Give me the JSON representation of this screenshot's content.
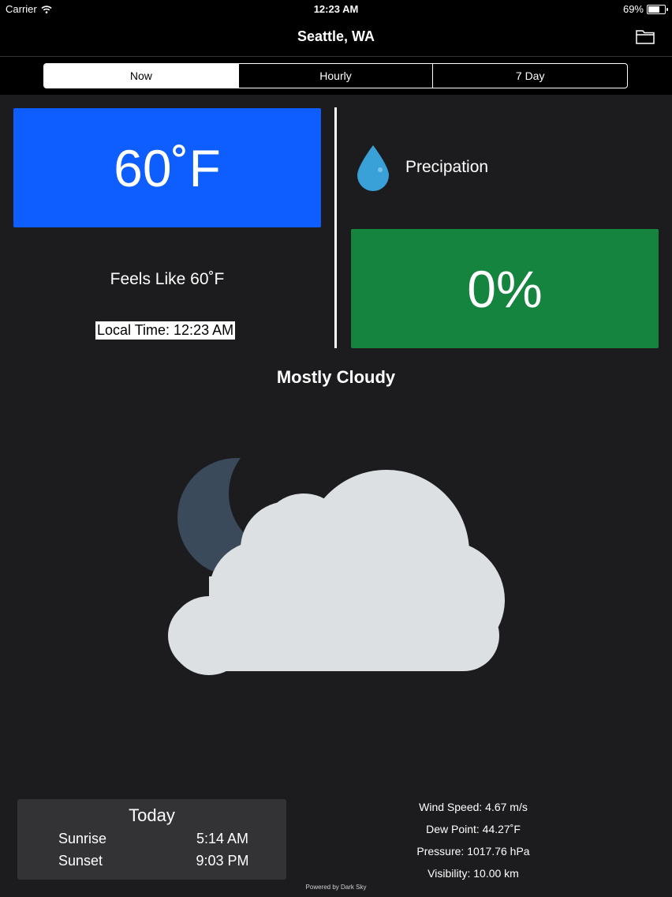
{
  "status": {
    "carrier": "Carrier",
    "time": "12:23 AM",
    "battery": "69%",
    "battery_level": 0.69
  },
  "nav": {
    "title": "Seattle, WA",
    "right_icon": "folder-icon"
  },
  "tabs": [
    {
      "label": "Now",
      "active": true
    },
    {
      "label": "Hourly",
      "active": false
    },
    {
      "label": "7 Day",
      "active": false
    }
  ],
  "current": {
    "temperature": "60˚F",
    "feels_like": "Feels Like 60˚F",
    "local_time": "Local Time: 12:23 AM",
    "precip_label": "Precipation",
    "precip_value": "0%",
    "summary": "Mostly Cloudy",
    "icon": "partly-cloudy-night-icon"
  },
  "today": {
    "title": "Today",
    "sunrise_label": "Sunrise",
    "sunrise_value": "5:14 AM",
    "sunset_label": "Sunset",
    "sunset_value": "9:03 PM"
  },
  "details": {
    "wind": "Wind Speed: 4.67 m/s",
    "dew": "Dew Point: 44.27˚F",
    "pressure": "Pressure: 1017.76 hPa",
    "visibility": "Visibility: 10.00 km"
  },
  "footer": {
    "powered_by": "Powered by Dark Sky"
  },
  "colors": {
    "temp_box": "#0d5dff",
    "precip_box": "#14843f",
    "background": "#1c1c1e",
    "moon": "#3a4a5a",
    "cloud": "#dde0e3",
    "drop": "#3aa0d8"
  }
}
